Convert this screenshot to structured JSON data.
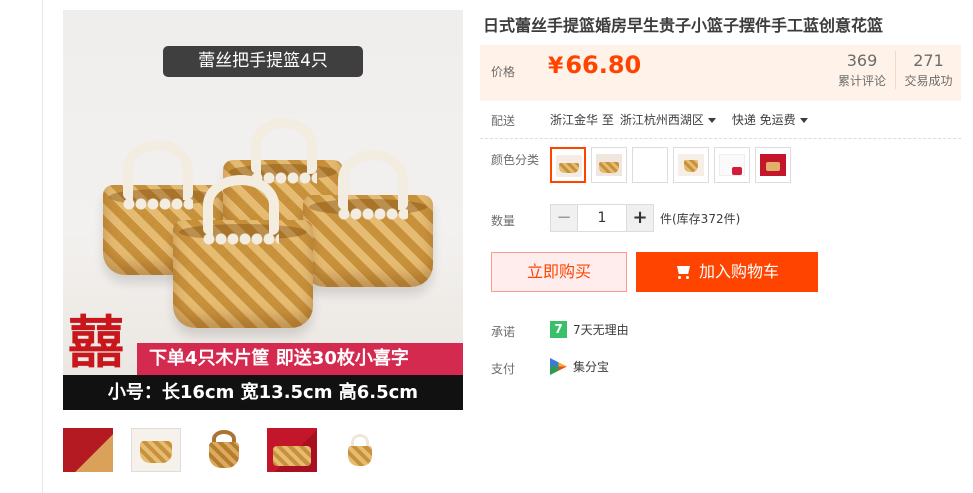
{
  "product": {
    "title": "日式蕾丝手提篮婚房早生贵子小篮子摆件手工蓝创意花篮"
  },
  "image": {
    "caption": "蕾丝把手提篮4只",
    "logo_char": "囍",
    "promo": "下单4只木片筐 即送30枚小喜字",
    "size": "小号：长16cm   宽13.5cm   高6.5cm",
    "thumbnails": [
      "thumb-red-set",
      "thumb-basket-box",
      "thumb-single-basket",
      "thumb-red-gift",
      "thumb-lace-basket"
    ]
  },
  "price": {
    "label": "价格",
    "currency": "¥",
    "amount": "66.80",
    "reviews_count": "369",
    "reviews_label": "累计评论",
    "sales_count": "271",
    "sales_label": "交易成功"
  },
  "shipping": {
    "label": "配送",
    "from": "浙江金华 至",
    "to": "浙江杭州西湖区",
    "method": "快递 免运费"
  },
  "color": {
    "label": "颜色分类",
    "options": [
      "option-1",
      "option-2",
      "option-3",
      "option-4",
      "option-5",
      "option-6"
    ]
  },
  "quantity": {
    "label": "数量",
    "minus": "−",
    "value": "1",
    "plus": "+",
    "stock": "件(库存372件)"
  },
  "actions": {
    "buy_now": "立即购买",
    "add_to_cart": "加入购物车"
  },
  "promise": {
    "label": "承诺",
    "icon": "7",
    "text": "7天无理由"
  },
  "payment": {
    "label": "支付",
    "text": "集分宝"
  },
  "colors": {
    "accent": "#ff4400",
    "price_bg": "#fff2e8",
    "buy_now_bg": "#ffeded"
  }
}
